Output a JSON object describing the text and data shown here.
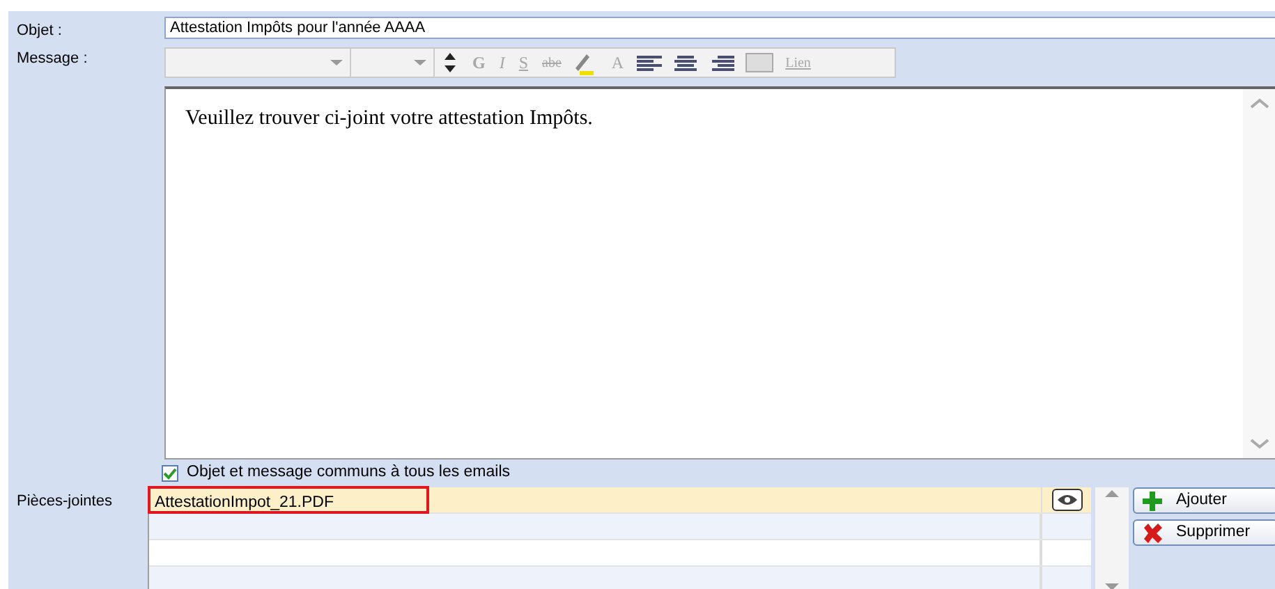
{
  "subject": {
    "label": "Objet :",
    "value": "Attestation Impôts pour l'année AAAA"
  },
  "message": {
    "label": "Message :",
    "toolbar": [
      {
        "kind": "dropdown"
      },
      {
        "kind": "dropdown-small"
      },
      {
        "kind": "spinner"
      },
      {
        "kind": "bold",
        "text": "G"
      },
      {
        "kind": "italic",
        "text": "I"
      },
      {
        "kind": "underline",
        "text": "S"
      },
      {
        "kind": "strike",
        "text": "abe"
      },
      {
        "kind": "highlight"
      },
      {
        "kind": "color",
        "text": "A"
      },
      {
        "kind": "align-left"
      },
      {
        "kind": "align-center"
      },
      {
        "kind": "align-right"
      },
      {
        "kind": "image"
      },
      {
        "kind": "link",
        "text": "Lien"
      }
    ],
    "body": "Veuillez trouver ci-joint votre attestation Impôts."
  },
  "common_checkbox": {
    "label": "Objet et message communs à tous les emails",
    "checked": true
  },
  "attachments": {
    "label": "Pièces-jointes",
    "rows": [
      {
        "name": "AttestationImpot_21.PDF",
        "selected": true,
        "outlined": true
      },
      {
        "selected": false,
        "outlined": false
      },
      {
        "selected": false,
        "outlined": false
      },
      {
        "selected": false,
        "outlined": false
      }
    ],
    "buttons": [
      {
        "kind": "add",
        "label": "Ajouter"
      },
      {
        "kind": "delete",
        "label": "Supprimer"
      }
    ]
  }
}
